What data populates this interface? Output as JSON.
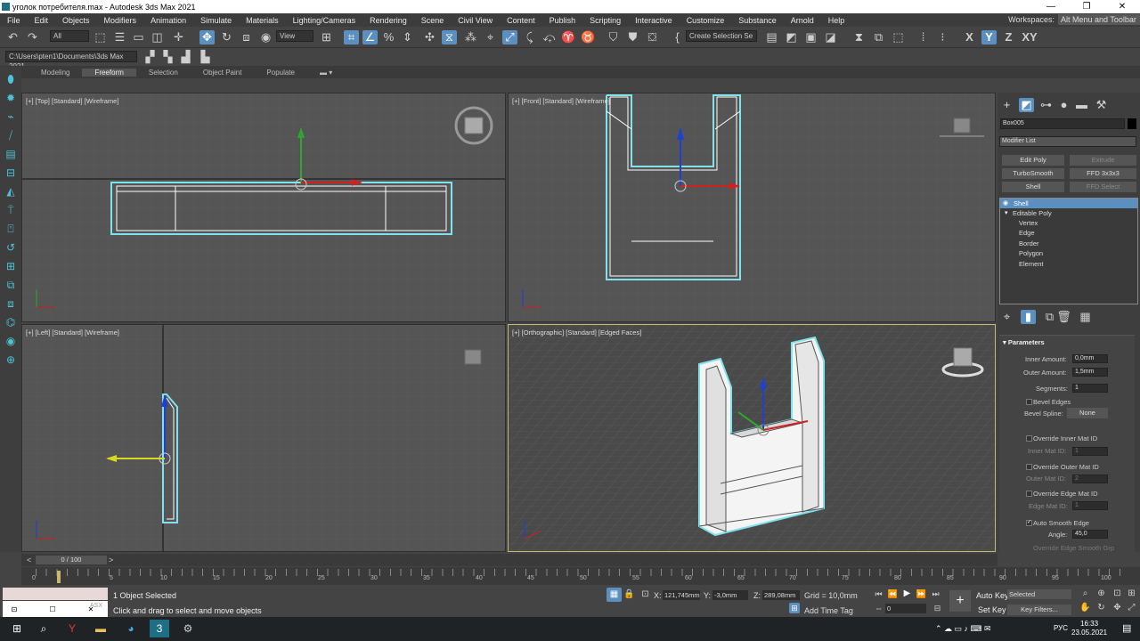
{
  "app": {
    "title": "уголок потребителя.max - Autodesk 3ds Max 2021",
    "minimize": "—",
    "maximize": "❐",
    "close": "✕"
  },
  "menu": [
    "File",
    "Edit",
    "Objects",
    "Modifiers",
    "Animation",
    "Simulate",
    "Materials",
    "Lighting/Cameras",
    "Rendering",
    "Scene",
    "Civil View",
    "Content",
    "Publish",
    "Scripting",
    "Interactive",
    "Customize",
    "Substance",
    "Arnold",
    "Help"
  ],
  "workspaces": {
    "label": "Workspaces:",
    "value": "Alt Menu and Toolbar"
  },
  "toolbar": {
    "filter": "All",
    "view": "View",
    "selection_set": "Create Selection Se",
    "axes": [
      "X",
      "Y",
      "Z",
      "XY"
    ]
  },
  "project_path": "C:\\Users\\pten1\\Documents\\3ds Max 2021",
  "ribbon_tabs": [
    "Modeling",
    "Freeform",
    "Selection",
    "Object Paint",
    "Populate"
  ],
  "viewports": {
    "top": "[+] [Top] [Standard] [Wireframe]",
    "front": "[+] [Front] [Standard] [Wireframe]",
    "left": "[+] [Left] [Standard] [Wireframe]",
    "ortho": "[+] [Orthographic] [Standard] [Edged Faces]"
  },
  "command_panel": {
    "object_name": "Box005",
    "modifier_list": "Modifier List",
    "mod_buttons": [
      {
        "label": "Edit Poly"
      },
      {
        "label": "Extrude"
      },
      {
        "label": "TurboSmooth"
      },
      {
        "label": "FFD 3x3x3"
      },
      {
        "label": "Shell"
      },
      {
        "label": "FFD Select"
      }
    ],
    "stack": [
      "Shell",
      "Editable Poly",
      "Vertex",
      "Edge",
      "Border",
      "Polygon",
      "Element"
    ],
    "rollout": "Parameters",
    "params": {
      "inner_label": "Inner Amount:",
      "inner": "0,0mm",
      "outer_label": "Outer Amount:",
      "outer": "1,5mm",
      "segments_label": "Segments:",
      "segments": "1",
      "bevel_edges": "Bevel Edges",
      "bevel_spline_label": "Bevel Spline:",
      "bevel_spline": "None",
      "override_inner": "Override Inner Mat ID",
      "inner_mat_label": "Inner Mat ID:",
      "inner_mat": "1",
      "override_outer": "Override Outer Mat ID",
      "outer_mat_label": "Outer Mat ID:",
      "outer_mat": "2",
      "override_edge": "Override Edge Mat ID",
      "edge_mat_label": "Edge Mat ID:",
      "edge_mat": "1",
      "auto_smooth": "Auto Smooth Edge",
      "angle_label": "Angle:",
      "angle": "45,0",
      "override_smooth": "Override Edge Smooth Grp"
    }
  },
  "timeline": {
    "frame": "0 / 100",
    "ticks": [
      "0",
      "5",
      "10",
      "15",
      "20",
      "25",
      "30",
      "35",
      "40",
      "45",
      "50",
      "55",
      "60",
      "65",
      "70",
      "75",
      "80",
      "85",
      "90",
      "95",
      "100"
    ]
  },
  "status": {
    "selected": "1 Object Selected",
    "prompt": "Click and drag to select and move objects",
    "x_label": "X:",
    "x": "121,745mm",
    "y_label": "Y:",
    "y": "-3,0mm",
    "z_label": "Z:",
    "z": "289,08mm",
    "grid": "Grid = 10,0mm",
    "add_time_tag": "Add Time Tag",
    "frame_field": "0",
    "auto_key": "Auto Key",
    "key_mode": "Selected",
    "set_key": "Set Key",
    "key_filters": "Key Filters...",
    "listener": "ASX"
  },
  "taskbar": {
    "lang": "РУС",
    "time": "16:33",
    "date": "23.05.2021"
  }
}
